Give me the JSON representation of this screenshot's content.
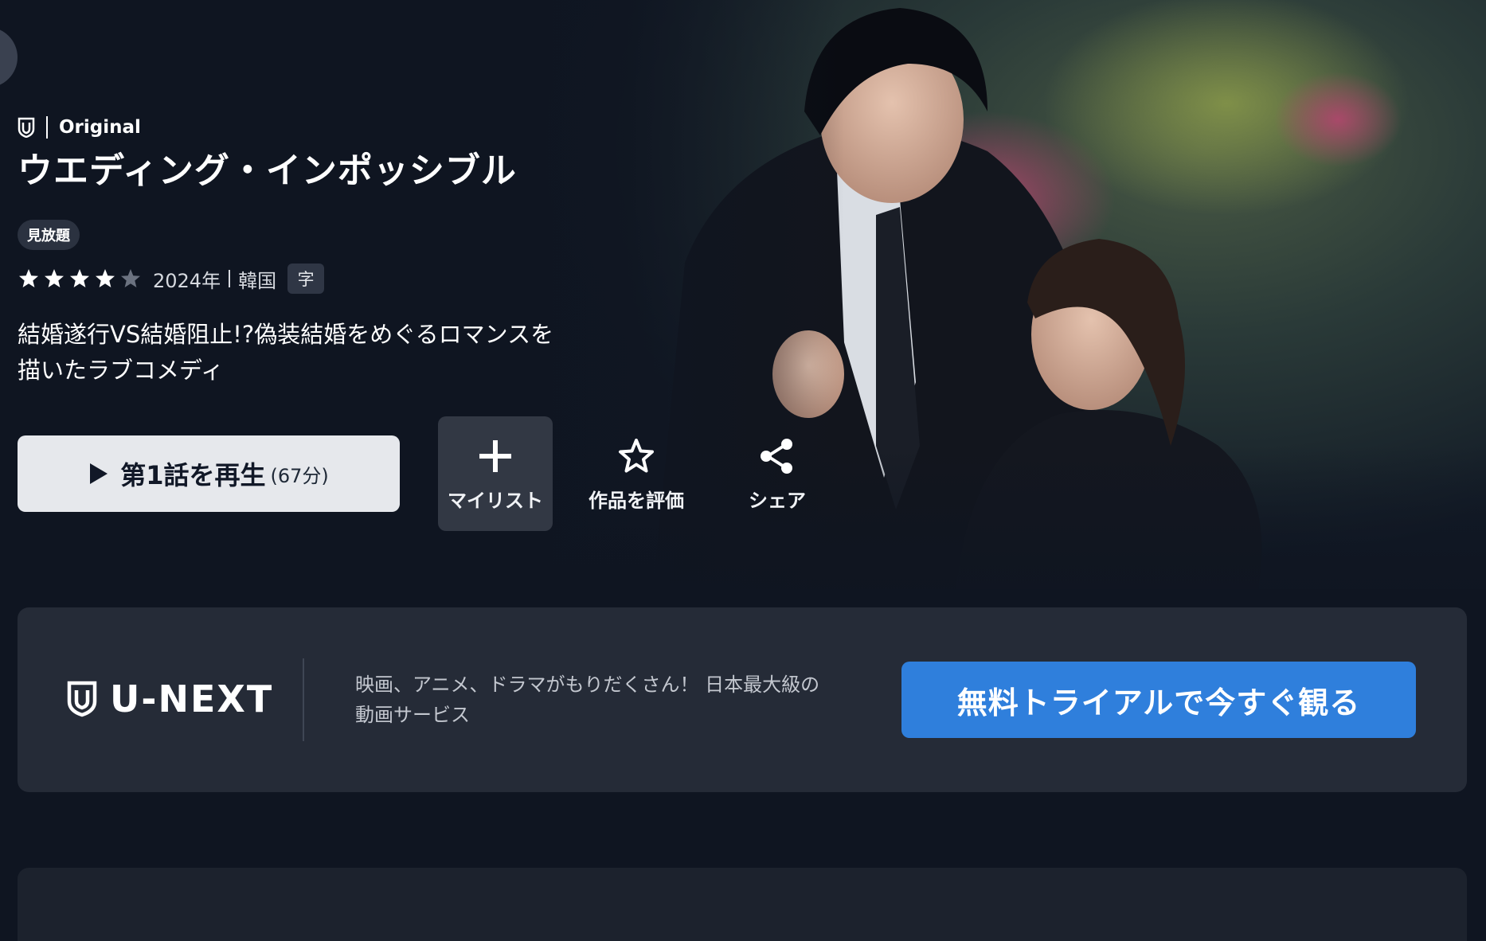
{
  "hero": {
    "brand_label": "Original",
    "title": "ウエディング・インポッシブル",
    "badge": "見放題",
    "rating": 4,
    "rating_max": 5,
    "year": "2024年",
    "country": "韓国",
    "subtitle_badge": "字",
    "description": "結婚遂行VS結婚阻止!?偽装結婚をめぐるロマンスを描いたラブコメディ",
    "play_label": "第1話を再生",
    "play_duration": "(67分)",
    "actions": {
      "mylist": "マイリスト",
      "rate": "作品を評価",
      "share": "シェア"
    }
  },
  "banner": {
    "logo_text": "U-NEXT",
    "text": "映画、アニメ、ドラマがもりだくさん！ 日本最大級の動画サービス",
    "cta": "無料トライアルで今すぐ観る"
  },
  "colors": {
    "background": "#0f1521",
    "banner": "#252b37",
    "cta": "#2f7fdc",
    "play_button": "#e6e8ec",
    "mylist_button": "#323844"
  },
  "icons": [
    "shield-icon",
    "star-icon",
    "play-icon",
    "plus-icon",
    "star-outline-icon",
    "share-icon"
  ]
}
